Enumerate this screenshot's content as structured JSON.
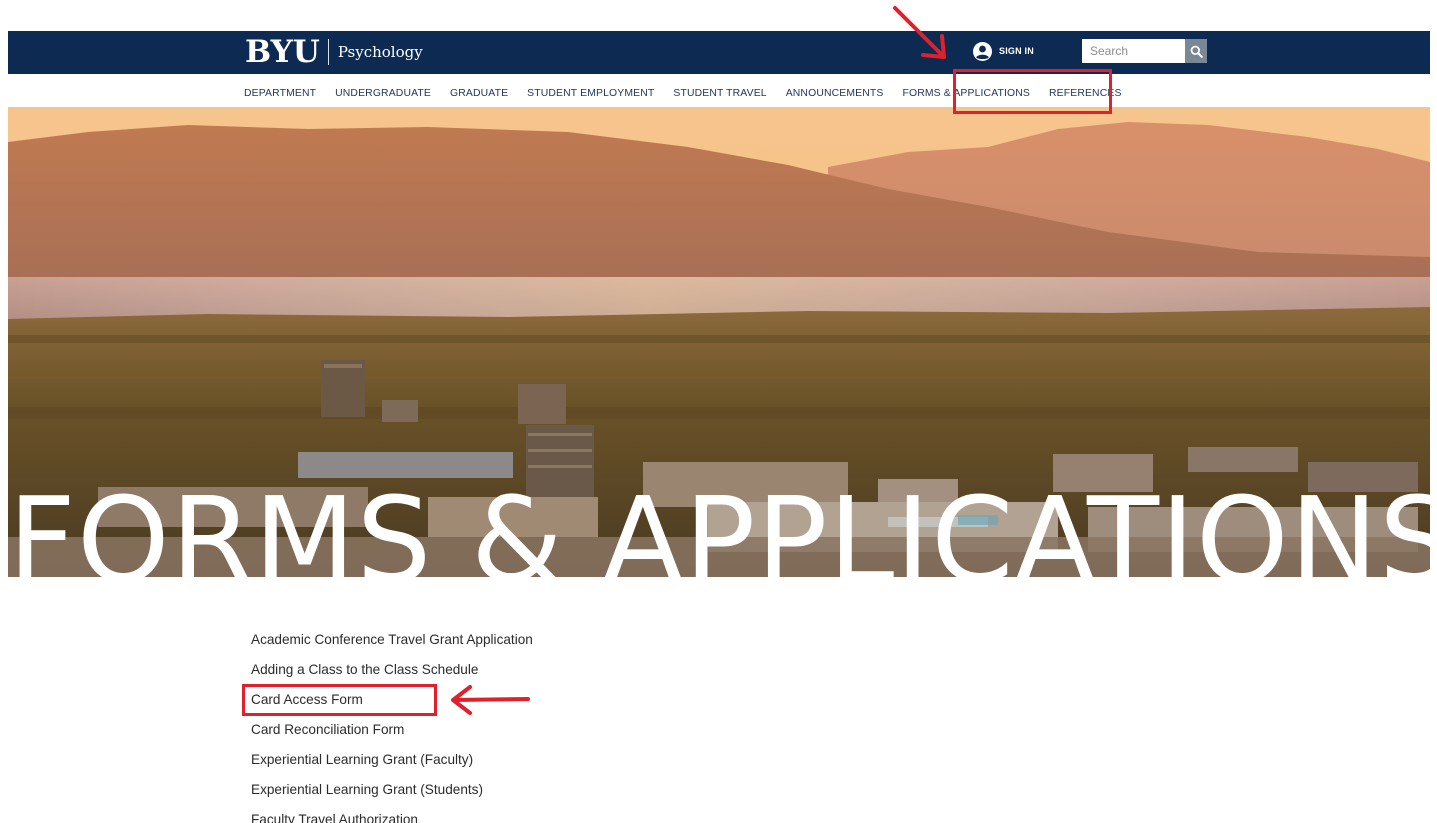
{
  "header": {
    "logo_text": "BYU",
    "unit_name": "Psychology",
    "signin_label": "SIGN IN",
    "search_placeholder": "Search",
    "colors": {
      "bar": "#0d2b52",
      "search_button": "#7a8795"
    }
  },
  "nav": {
    "items": [
      "DEPARTMENT",
      "UNDERGRADUATE",
      "GRADUATE",
      "STUDENT EMPLOYMENT",
      "STUDENT TRAVEL",
      "ANNOUNCEMENTS",
      "FORMS & APPLICATIONS",
      "REFERENCES"
    ],
    "highlighted": "FORMS & APPLICATIONS"
  },
  "hero": {
    "title": "FORMS & APPLICATIONS"
  },
  "forms": {
    "items": [
      "Academic Conference Travel Grant Application",
      "Adding a Class to the Class Schedule",
      "Card Access Form",
      "Card Reconciliation Form",
      "Experiential Learning Grant (Faculty)",
      "Experiential Learning Grant (Students)",
      "Faculty Travel Authorization"
    ],
    "highlighted": "Card Access Form"
  },
  "annotation_color": "#e0202a",
  "icons": [
    "user-circle-icon",
    "search-icon",
    "arrow-icon"
  ]
}
